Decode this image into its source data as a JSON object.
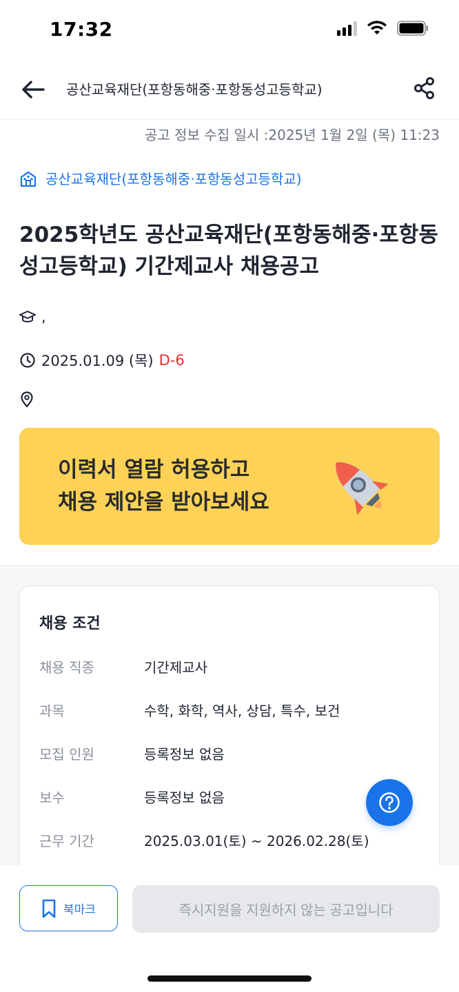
{
  "status_bar": {
    "time": "17:32"
  },
  "header": {
    "title": "공산교육재단(포항동해중·포항동성고등학교)"
  },
  "collected_at": "공고 정보 수집 일시 :2025년 1월 2일 (목) 11:23",
  "organization": {
    "name": "공산교육재단(포항동해중·포항동성고등학교)"
  },
  "job": {
    "title": "2025학년도 공산교육재단(포항동해중·포항동성고등학교) 기간제교사 채용공고",
    "education": ",",
    "deadline": "2025.01.09 (목)",
    "dday": "D-6",
    "location": ""
  },
  "banner": {
    "line1": "이력서 열람 허용하고",
    "line2": "채용 제안을 받아보세요"
  },
  "conditions": {
    "title": "채용 조건",
    "rows": [
      {
        "label": "채용 직종",
        "value": "기간제교사"
      },
      {
        "label": "과목",
        "value": "수학, 화학, 역사, 상담, 특수, 보건"
      },
      {
        "label": "모집 인원",
        "value": "등록정보 없음"
      },
      {
        "label": "보수",
        "value": "등록정보 없음"
      },
      {
        "label": "근무 기간",
        "value": "2025.03.01(토) ~ 2026.02.28(토)"
      }
    ]
  },
  "bottom": {
    "bookmark_label": "북마크",
    "apply_label": "즉시지원을 지원하지 않는 공고입니다"
  },
  "colors": {
    "accent": "#1a73e8",
    "dday": "#e03131",
    "banner": "#fdd256"
  }
}
